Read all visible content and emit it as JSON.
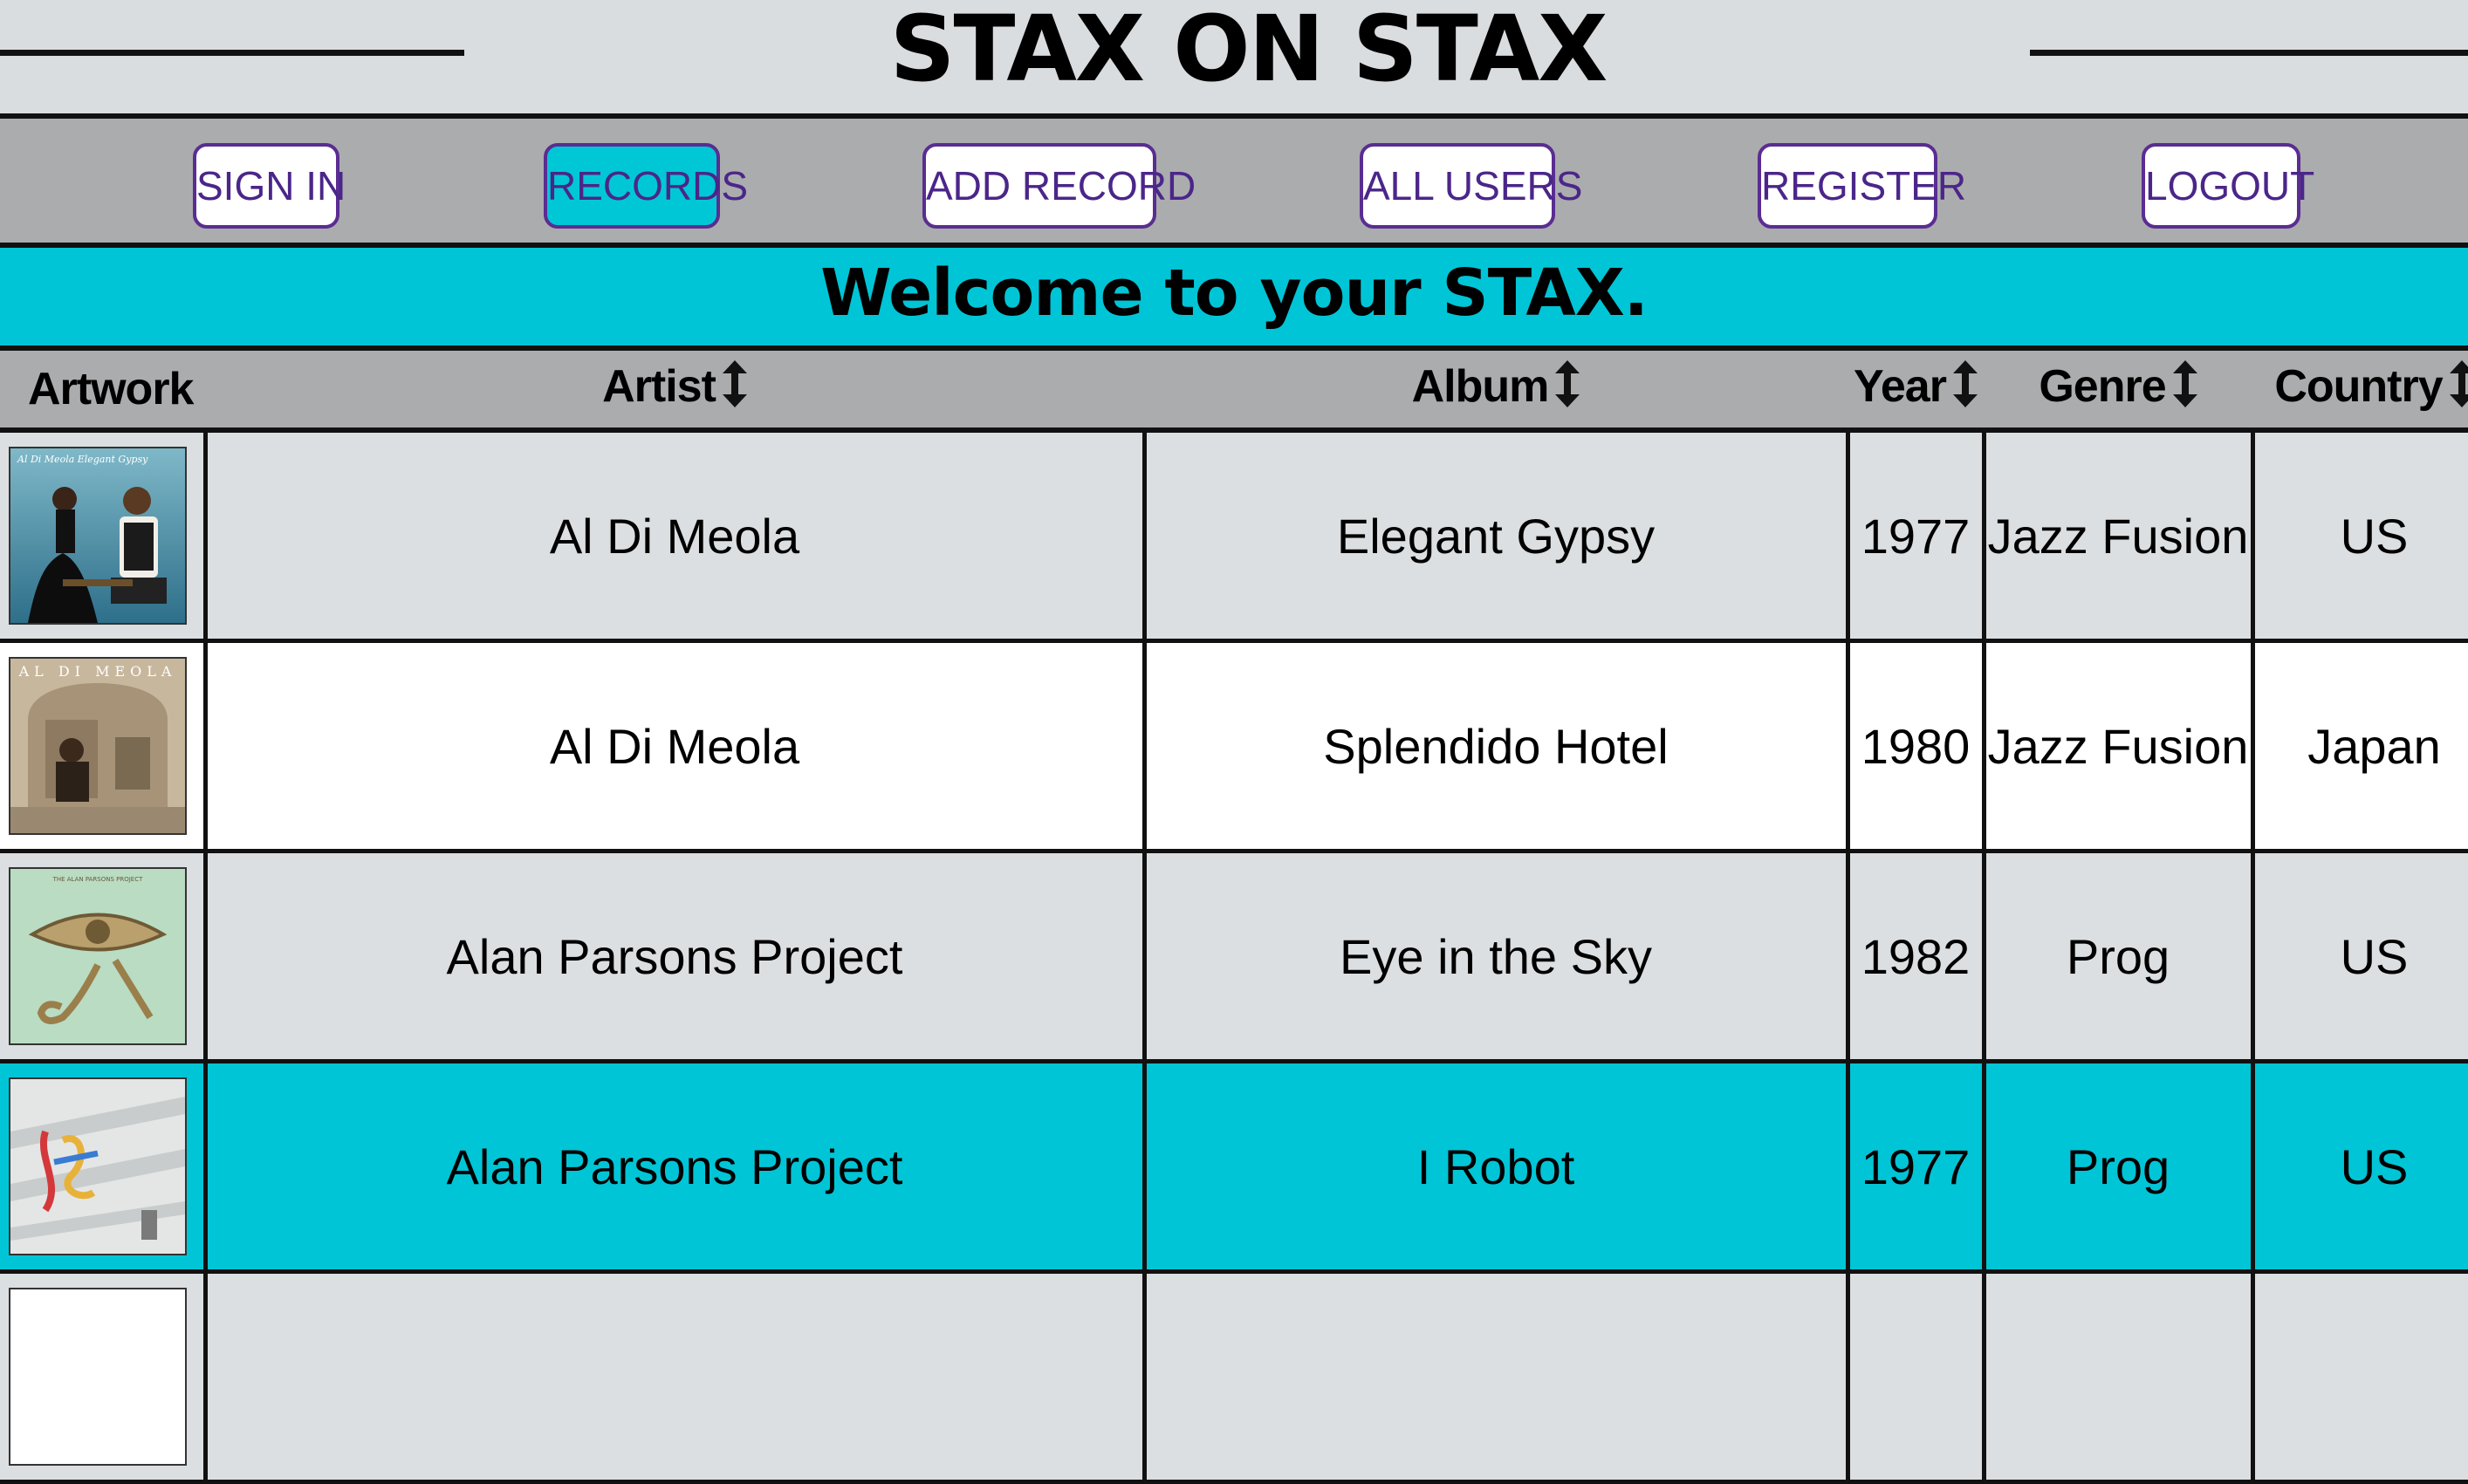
{
  "header": {
    "title": "STAX ON STAX"
  },
  "nav": {
    "items": [
      {
        "label": "SIGN IN",
        "active": false
      },
      {
        "label": "RECORDS",
        "active": true
      },
      {
        "label": "ADD RECORD",
        "active": false
      },
      {
        "label": "ALL USERS",
        "active": false
      },
      {
        "label": "REGISTER",
        "active": false
      },
      {
        "label": "LOGOUT",
        "active": false
      }
    ]
  },
  "welcome": "Welcome to your STAX.",
  "table": {
    "headers": {
      "artwork": "Artwork",
      "artist": "Artist",
      "album": "Album",
      "year": "Year",
      "genre": "Genre",
      "country": "Country"
    },
    "rows": [
      {
        "artist": "Al Di Meola",
        "album": "Elegant Gypsy",
        "year": "1977",
        "genre": "Jazz Fusion",
        "country": "US",
        "cover_text": "Al Di Meola   Elegant Gypsy"
      },
      {
        "artist": "Al Di Meola",
        "album": "Splendido Hotel",
        "year": "1980",
        "genre": "Jazz Fusion",
        "country": "Japan",
        "cover_text": "AL DI MEOLA"
      },
      {
        "artist": "Alan Parsons Project",
        "album": "Eye in the Sky",
        "year": "1982",
        "genre": "Prog",
        "country": "US",
        "cover_text": "THE ALAN PARSONS PROJECT"
      },
      {
        "artist": "Alan Parsons Project",
        "album": "I Robot",
        "year": "1977",
        "genre": "Prog",
        "country": "US",
        "cover_text": ""
      }
    ]
  },
  "colors": {
    "accent": "#00c5d6",
    "nav_text": "#4b2689",
    "page_bg": "#dadddf",
    "bar_bg": "#abacae"
  },
  "icons": {
    "sort": "sort-arrows-icon"
  }
}
